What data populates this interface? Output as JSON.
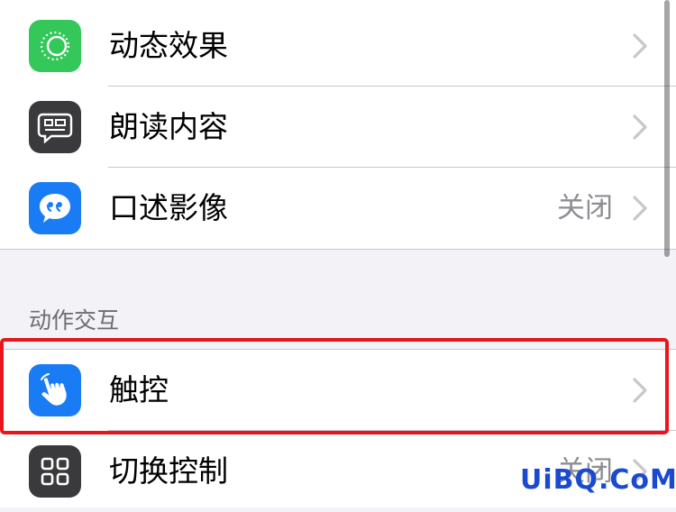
{
  "colors": {
    "green_icon": "#34c759",
    "gray_icon": "#3a3a3c",
    "blue_icon": "#1a7cf5",
    "highlight": "#e8161a",
    "watermark": "#1a4ad0"
  },
  "rows_top": [
    {
      "label": "动态效果",
      "value": "",
      "icon": "motion-effect-icon"
    },
    {
      "label": "朗读内容",
      "value": "",
      "icon": "spoken-content-icon"
    },
    {
      "label": "口述影像",
      "value": "关闭",
      "icon": "audio-description-icon"
    }
  ],
  "section_header": "动作交互",
  "rows_motion": [
    {
      "label": "触控",
      "value": "",
      "icon": "touch-hand-icon"
    },
    {
      "label": "切换控制",
      "value": "关闭",
      "icon": "switch-control-grid-icon"
    }
  ],
  "watermark": "UiBQ.CoM"
}
